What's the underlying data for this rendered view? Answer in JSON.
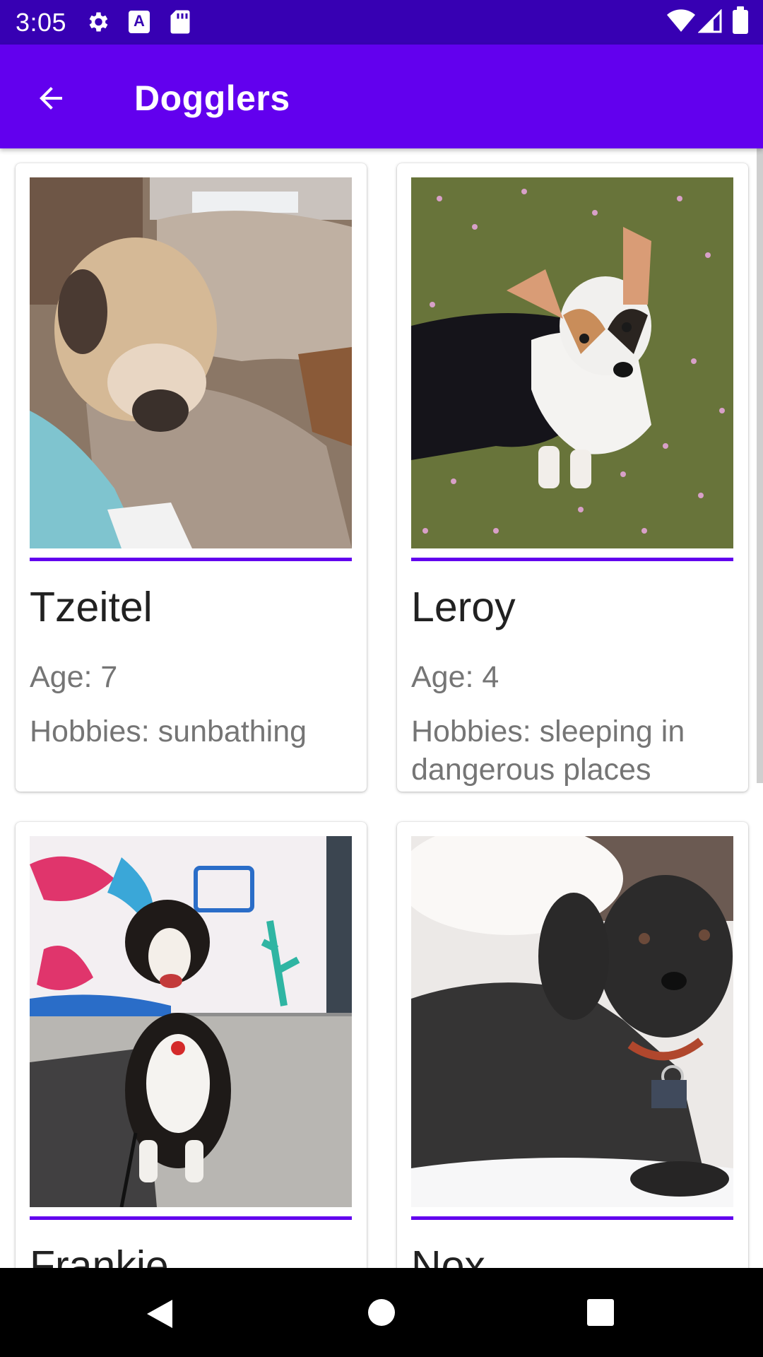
{
  "status_bar": {
    "time": "3:05",
    "icons": [
      "gear-icon",
      "a-icon",
      "sd-card-icon",
      "wifi-icon",
      "cell-signal-icon",
      "battery-icon"
    ],
    "a_glyph": "A"
  },
  "app_bar": {
    "title": "Dogglers",
    "back_icon": "arrow-back-icon",
    "background": "#6200ee"
  },
  "colors": {
    "status_bar": "#3700b3",
    "accent": "#6200ee",
    "name_text": "#212121",
    "secondary_text": "#757575"
  },
  "dogs": [
    {
      "name": "Tzeitel",
      "age": "Age: 7",
      "hobbies": "Hobbies: sunbathing"
    },
    {
      "name": "Leroy",
      "age": "Age: 4",
      "hobbies": "Hobbies: sleeping in dangerous places"
    },
    {
      "name": "Frankie",
      "age": "",
      "hobbies": ""
    },
    {
      "name": "Nox",
      "age": "",
      "hobbies": ""
    }
  ],
  "nav_bar": {
    "icons": [
      "back-triangle-icon",
      "home-circle-icon",
      "recents-square-icon"
    ]
  }
}
